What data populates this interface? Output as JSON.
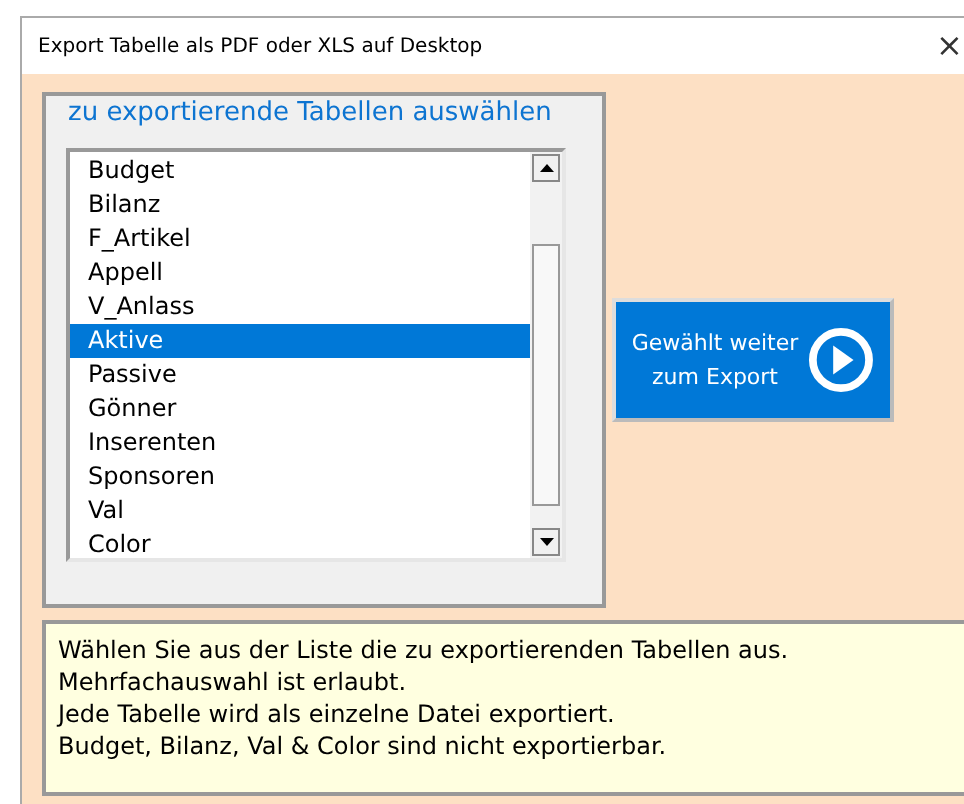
{
  "window": {
    "title": "Export Tabelle als PDF oder XLS auf Desktop",
    "close": "×"
  },
  "frame": {
    "title": "zu exportierende Tabellen auswählen"
  },
  "list": {
    "items": [
      {
        "label": "Budget",
        "selected": false
      },
      {
        "label": "Bilanz",
        "selected": false
      },
      {
        "label": "F_Artikel",
        "selected": false
      },
      {
        "label": "Appell",
        "selected": false
      },
      {
        "label": "V_Anlass",
        "selected": false
      },
      {
        "label": "Aktive",
        "selected": true
      },
      {
        "label": "Passive",
        "selected": false
      },
      {
        "label": "Gönner",
        "selected": false
      },
      {
        "label": "Inserenten",
        "selected": false
      },
      {
        "label": "Sponsoren",
        "selected": false
      },
      {
        "label": "Val",
        "selected": false
      },
      {
        "label": "Color",
        "selected": false
      }
    ]
  },
  "export_button": {
    "label": "Gewählt weiter zum Export"
  },
  "info": {
    "lines": [
      "Wählen Sie aus der Liste die zu exportierenden Tabellen aus.",
      "Mehrfachauswahl ist erlaubt.",
      "Jede Tabelle wird als einzelne Datei exportiert.",
      "Budget, Bilanz, Val & Color sind nicht exportierbar."
    ]
  }
}
